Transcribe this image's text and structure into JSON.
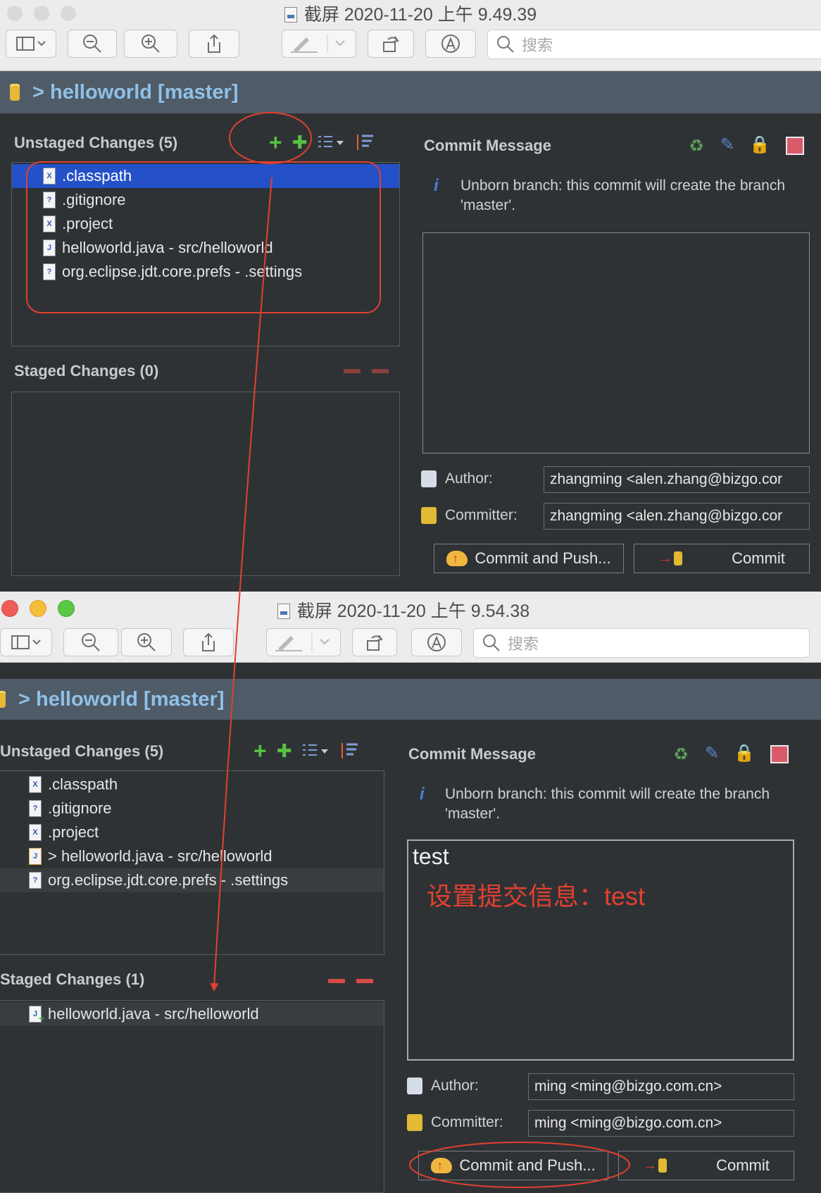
{
  "windows": [
    {
      "title": "截屏 2020-11-20 上午 9.49.39",
      "search_placeholder": "搜索",
      "repo_label": "> helloworld [master]",
      "unstaged_title": "Unstaged Changes (5)",
      "unstaged_items": [
        ".classpath",
        ".gitignore",
        ".project",
        "helloworld.java - src/helloworld",
        "org.eclipse.jdt.core.prefs - .settings"
      ],
      "staged_title": "Staged Changes (0)",
      "staged_items": [],
      "commit_message_title": "Commit Message",
      "info_text": "Unborn branch: this commit will create the branch 'master'.",
      "message": "",
      "author_label": "Author:",
      "author_value": "zhangming <alen.zhang@bizgo.cor",
      "committer_label": "Committer:",
      "committer_value": "zhangming <alen.zhang@bizgo.cor",
      "commit_push_label": "Commit and Push...",
      "commit_label": "Commit"
    },
    {
      "title": "截屏 2020-11-20 上午 9.54.38",
      "search_placeholder": "搜索",
      "repo_label": "> helloworld [master]",
      "unstaged_title": "Unstaged Changes (5)",
      "unstaged_items": [
        ".classpath",
        ".gitignore",
        ".project",
        "> helloworld.java - src/helloworld",
        "org.eclipse.jdt.core.prefs - .settings"
      ],
      "staged_title": "Staged Changes (1)",
      "staged_items": [
        "helloworld.java - src/helloworld"
      ],
      "commit_message_title": "Commit Message",
      "info_text": "Unborn branch: this commit will create the branch 'master'.",
      "message": "test",
      "author_label": "Author:",
      "author_value": "ming <ming@bizgo.com.cn>",
      "committer_label": "Committer:",
      "committer_value": "ming <ming@bizgo.com.cn>",
      "commit_push_label": "Commit and Push...",
      "commit_label": "Commit"
    }
  ],
  "annotation_text": "设置提交信息：test",
  "colors": {
    "annotation": "#e2402f",
    "selection": "#2451c8",
    "repo_text": "#8fc1e8",
    "panel_bg": "#2f3235"
  },
  "icons": [
    "search-icon",
    "zoom-out-icon",
    "zoom-in-icon",
    "share-icon",
    "markup-icon",
    "rotate-icon",
    "annotate-icon",
    "add-to-index-icon",
    "add-all-icon",
    "presentation-icon",
    "sort-icon",
    "remove-from-index-icon",
    "remove-all-icon",
    "info-icon"
  ]
}
